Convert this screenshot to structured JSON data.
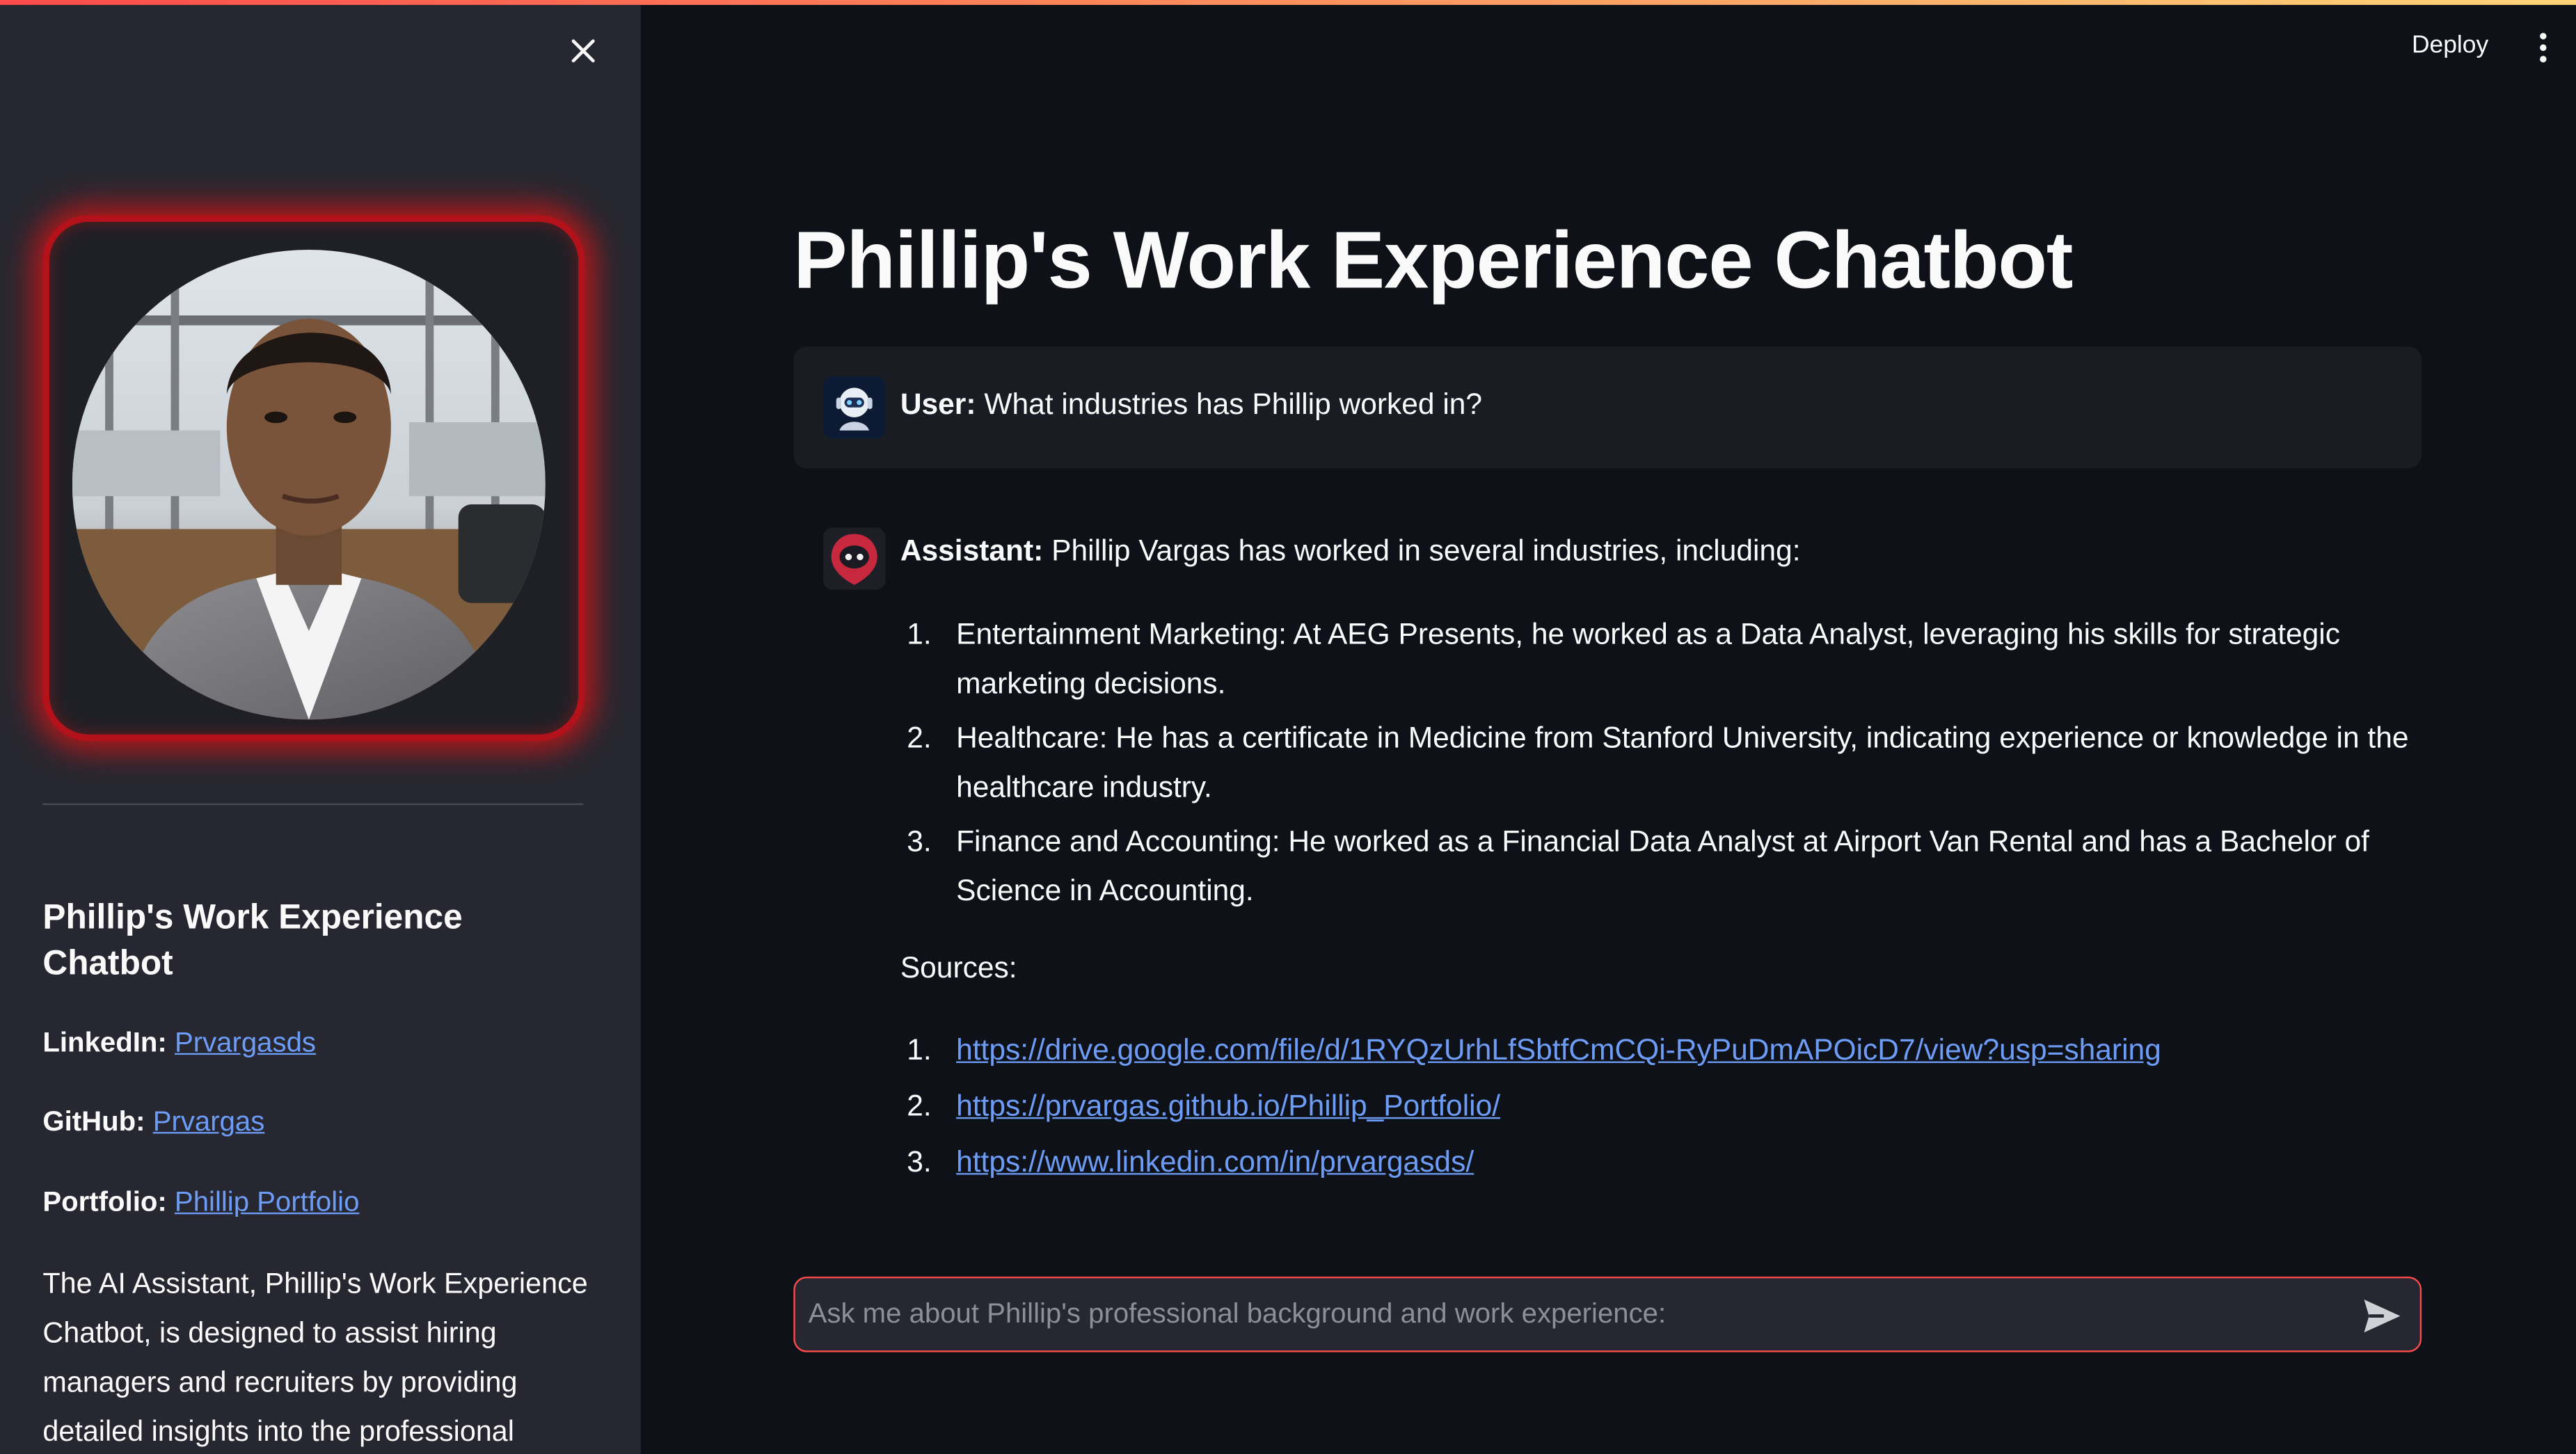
{
  "app": {
    "deploy_label": "Deploy"
  },
  "sidebar": {
    "title": "Phillip's Work Experience Chatbot",
    "links": [
      {
        "label": "LinkedIn:",
        "text": "Prvargasds"
      },
      {
        "label": "GitHub:",
        "text": "Prvargas"
      },
      {
        "label": "Portfolio:",
        "text": "Phillip Portfolio"
      }
    ],
    "description": "The AI Assistant, Phillip's Work Experience Chatbot, is designed to assist hiring managers and recruiters by providing detailed insights into the professional"
  },
  "main": {
    "title": "Phillip's Work Experience Chatbot",
    "user_message": {
      "role": "User:",
      "text": "What industries has Phillip worked in?"
    },
    "assistant_message": {
      "role": "Assistant:",
      "intro": "Phillip Vargas has worked in several industries, including:",
      "items": [
        {
          "num": "1.",
          "text": "Entertainment Marketing: At AEG Presents, he worked as a Data Analyst, leveraging his skills for strategic marketing decisions."
        },
        {
          "num": "2.",
          "text": "Healthcare: He has a certificate in Medicine from Stanford University, indicating experience or knowledge in the healthcare industry."
        },
        {
          "num": "3.",
          "text": "Finance and Accounting: He worked as a Financial Data Analyst at Airport Van Rental and has a Bachelor of Science in Accounting."
        }
      ],
      "sources_label": "Sources:",
      "sources": [
        {
          "num": "1.",
          "url": "https://drive.google.com/file/d/1RYQzUrhLfSbtfCmCQi-RyPuDmAPOicD7/view?usp=sharing"
        },
        {
          "num": "2.",
          "url": "https://prvargas.github.io/Phillip_Portfolio/"
        },
        {
          "num": "3.",
          "url": "https://www.linkedin.com/in/prvargasds/"
        }
      ]
    },
    "chat_input": {
      "placeholder": "Ask me about Phillip's professional background and work experience:",
      "value": ""
    }
  },
  "icons": {
    "close": "close-icon",
    "menu": "kebab-menu-icon",
    "send": "send-icon",
    "user_avatar": "user-robot-avatar-icon",
    "assistant_avatar": "assistant-robot-avatar-icon"
  },
  "colors": {
    "accent": "#ff4b4b",
    "link": "#6c9cf5",
    "background": "#0e1117",
    "sidebar": "#262730",
    "avatar_glow": "#e01414"
  }
}
